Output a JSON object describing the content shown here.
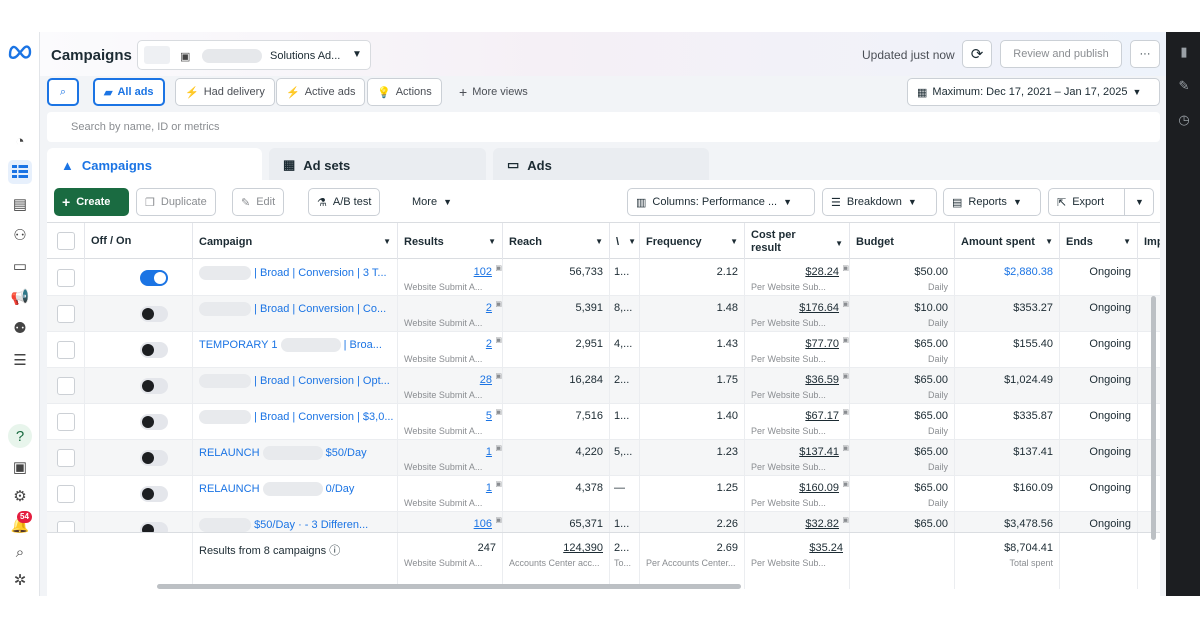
{
  "header": {
    "title": "Campaigns",
    "account_name": "Solutions Ad...",
    "updated": "Updated just now",
    "review_label": "Review and publish",
    "more_label": "···"
  },
  "notifications": {
    "count": "54"
  },
  "filters": {
    "all_ads": "All ads",
    "had_delivery": "Had delivery",
    "active_ads": "Active ads",
    "actions": "Actions",
    "more_views": "More views",
    "date_range": "Maximum: Dec 17, 2021 – Jan 17, 2025"
  },
  "search": {
    "placeholder": "Search by name, ID or metrics"
  },
  "tabs": {
    "campaigns": "Campaigns",
    "ad_sets": "Ad sets",
    "ads": "Ads"
  },
  "toolbar": {
    "create": "Create",
    "duplicate": "Duplicate",
    "edit": "Edit",
    "ab_test": "A/B test",
    "more": "More",
    "columns": "Columns: Performance ...",
    "breakdown": "Breakdown",
    "reports": "Reports",
    "export": "Export"
  },
  "columns": {
    "off_on": "Off / On",
    "campaign": "Campaign",
    "results": "Results",
    "reach": "Reach",
    "trunc": "\\",
    "frequency": "Frequency",
    "cost_per_result": "Cost per result",
    "budget": "Budget",
    "amount_spent": "Amount spent",
    "ends": "Ends",
    "impressions": "Impression"
  },
  "rows": [
    {
      "on": true,
      "prefix": "",
      "name": "| Broad | Conversion | 3 T...",
      "results": "102",
      "results_sub": "Website Submit A...",
      "reach": "56,733",
      "trunc": "1...",
      "frequency": "2.12",
      "cost": "$28.24",
      "cost_sub": "Per Website Sub...",
      "budget": "$50.00",
      "budget_sub": "Daily",
      "spent": "$2,880.38",
      "spent_link": true,
      "ends": "Ongoing"
    },
    {
      "on": false,
      "prefix": "",
      "name": "| Broad | Conversion | Co...",
      "results": "2",
      "results_sub": "Website Submit A...",
      "reach": "5,391",
      "trunc": "8,...",
      "frequency": "1.48",
      "cost": "$176.64",
      "cost_sub": "Per Website Sub...",
      "budget": "$10.00",
      "budget_sub": "Daily",
      "spent": "$353.27",
      "spent_link": false,
      "ends": "Ongoing"
    },
    {
      "on": false,
      "prefix": "TEMPORARY 1",
      "name": "| Broa...",
      "results": "2",
      "results_sub": "Website Submit A...",
      "reach": "2,951",
      "trunc": "4,...",
      "frequency": "1.43",
      "cost": "$77.70",
      "cost_sub": "Per Website Sub...",
      "budget": "$65.00",
      "budget_sub": "Daily",
      "spent": "$155.40",
      "spent_link": false,
      "ends": "Ongoing"
    },
    {
      "on": false,
      "prefix": "",
      "name": "| Broad | Conversion | Opt...",
      "results": "28",
      "results_sub": "Website Submit A...",
      "reach": "16,284",
      "trunc": "2...",
      "frequency": "1.75",
      "cost": "$36.59",
      "cost_sub": "Per Website Sub...",
      "budget": "$65.00",
      "budget_sub": "Daily",
      "spent": "$1,024.49",
      "spent_link": false,
      "ends": "Ongoing"
    },
    {
      "on": false,
      "prefix": "",
      "name": "| Broad | Conversion | $3,0...",
      "results": "5",
      "results_sub": "Website Submit A...",
      "reach": "7,516",
      "trunc": "1...",
      "frequency": "1.40",
      "cost": "$67.17",
      "cost_sub": "Per Website Sub...",
      "budget": "$65.00",
      "budget_sub": "Daily",
      "spent": "$335.87",
      "spent_link": false,
      "ends": "Ongoing"
    },
    {
      "on": false,
      "prefix": "RELAUNCH",
      "name": "$50/Day",
      "results": "1",
      "results_sub": "Website Submit A...",
      "reach": "4,220",
      "trunc": "5,...",
      "frequency": "1.23",
      "cost": "$137.41",
      "cost_sub": "Per Website Sub...",
      "budget": "$65.00",
      "budget_sub": "Daily",
      "spent": "$137.41",
      "spent_link": false,
      "ends": "Ongoing"
    },
    {
      "on": false,
      "prefix": "RELAUNCH",
      "name": "0/Day",
      "results": "1",
      "results_sub": "Website Submit A...",
      "reach": "4,378",
      "trunc": "—",
      "frequency": "1.25",
      "cost": "$160.09",
      "cost_sub": "Per Website Sub...",
      "budget": "$65.00",
      "budget_sub": "Daily",
      "spent": "$160.09",
      "spent_link": false,
      "ends": "Ongoing"
    },
    {
      "on": false,
      "prefix": "",
      "name": "$50/Day · - 3 Differen...",
      "results": "106",
      "results_sub": "",
      "reach": "65,371",
      "trunc": "1...",
      "frequency": "2.26",
      "cost": "$32.82",
      "cost_sub": "",
      "budget": "$65.00",
      "budget_sub": "",
      "spent": "$3,478.56",
      "spent_link": false,
      "ends": "Ongoing"
    }
  ],
  "totals": {
    "label": "Results from 8 campaigns",
    "results": "247",
    "results_sub": "Website Submit A...",
    "reach": "124,390",
    "reach_sub": "Accounts Center acc...",
    "trunc": "2...",
    "trunc_sub": "To...",
    "frequency": "2.69",
    "frequency_sub": "Per Accounts Center...",
    "cost": "$35.24",
    "cost_sub": "Per Website Sub...",
    "spent": "$8,704.41",
    "spent_sub": "Total spent"
  },
  "colors": {
    "accent": "#1b74e4",
    "create": "#1a6b41",
    "badge": "#e41e3f"
  }
}
